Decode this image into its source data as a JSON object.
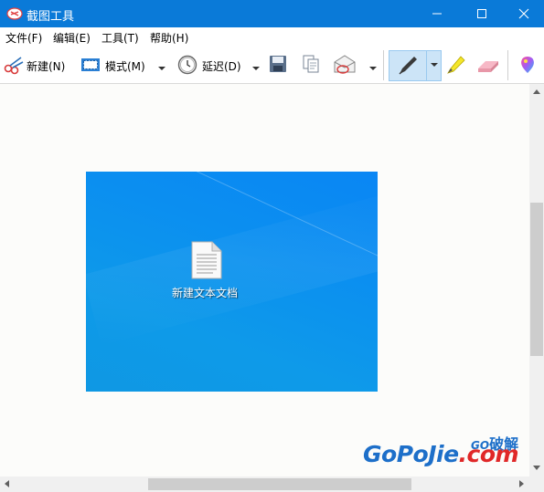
{
  "window": {
    "title": "截图工具",
    "controls": [
      "minimize",
      "maximize",
      "close"
    ]
  },
  "menu": [
    {
      "label": "文件(F)"
    },
    {
      "label": "编辑(E)"
    },
    {
      "label": "工具(T)"
    },
    {
      "label": "帮助(H)"
    }
  ],
  "toolbar": {
    "new_label": "新建(N)",
    "mode_label": "模式(M)",
    "delay_label": "延迟(D)",
    "icons": [
      "scissors-icon",
      "rectangle-snip-icon",
      "clock-icon",
      "save-icon",
      "copy-icon",
      "send-email-icon",
      "pen-icon",
      "highlighter-icon",
      "eraser-icon",
      "paint3d-icon"
    ],
    "active_tool": "pen"
  },
  "capture": {
    "desktop_file_label": "新建文本文档",
    "background_color": "#0a8ff0"
  },
  "scrollbars": {
    "vertical": "visible",
    "horizontal": "visible"
  },
  "watermark": {
    "brand_main": "GoPoJie",
    "brand_suffix": ".com",
    "tag_prefix": "GO",
    "tag_text": "破解"
  },
  "colors": {
    "titlebar": "#0a7ad8",
    "active_tool_bg": "#cce4f7",
    "watermark_blue": "#1d6fc9",
    "watermark_red": "#e02828"
  }
}
